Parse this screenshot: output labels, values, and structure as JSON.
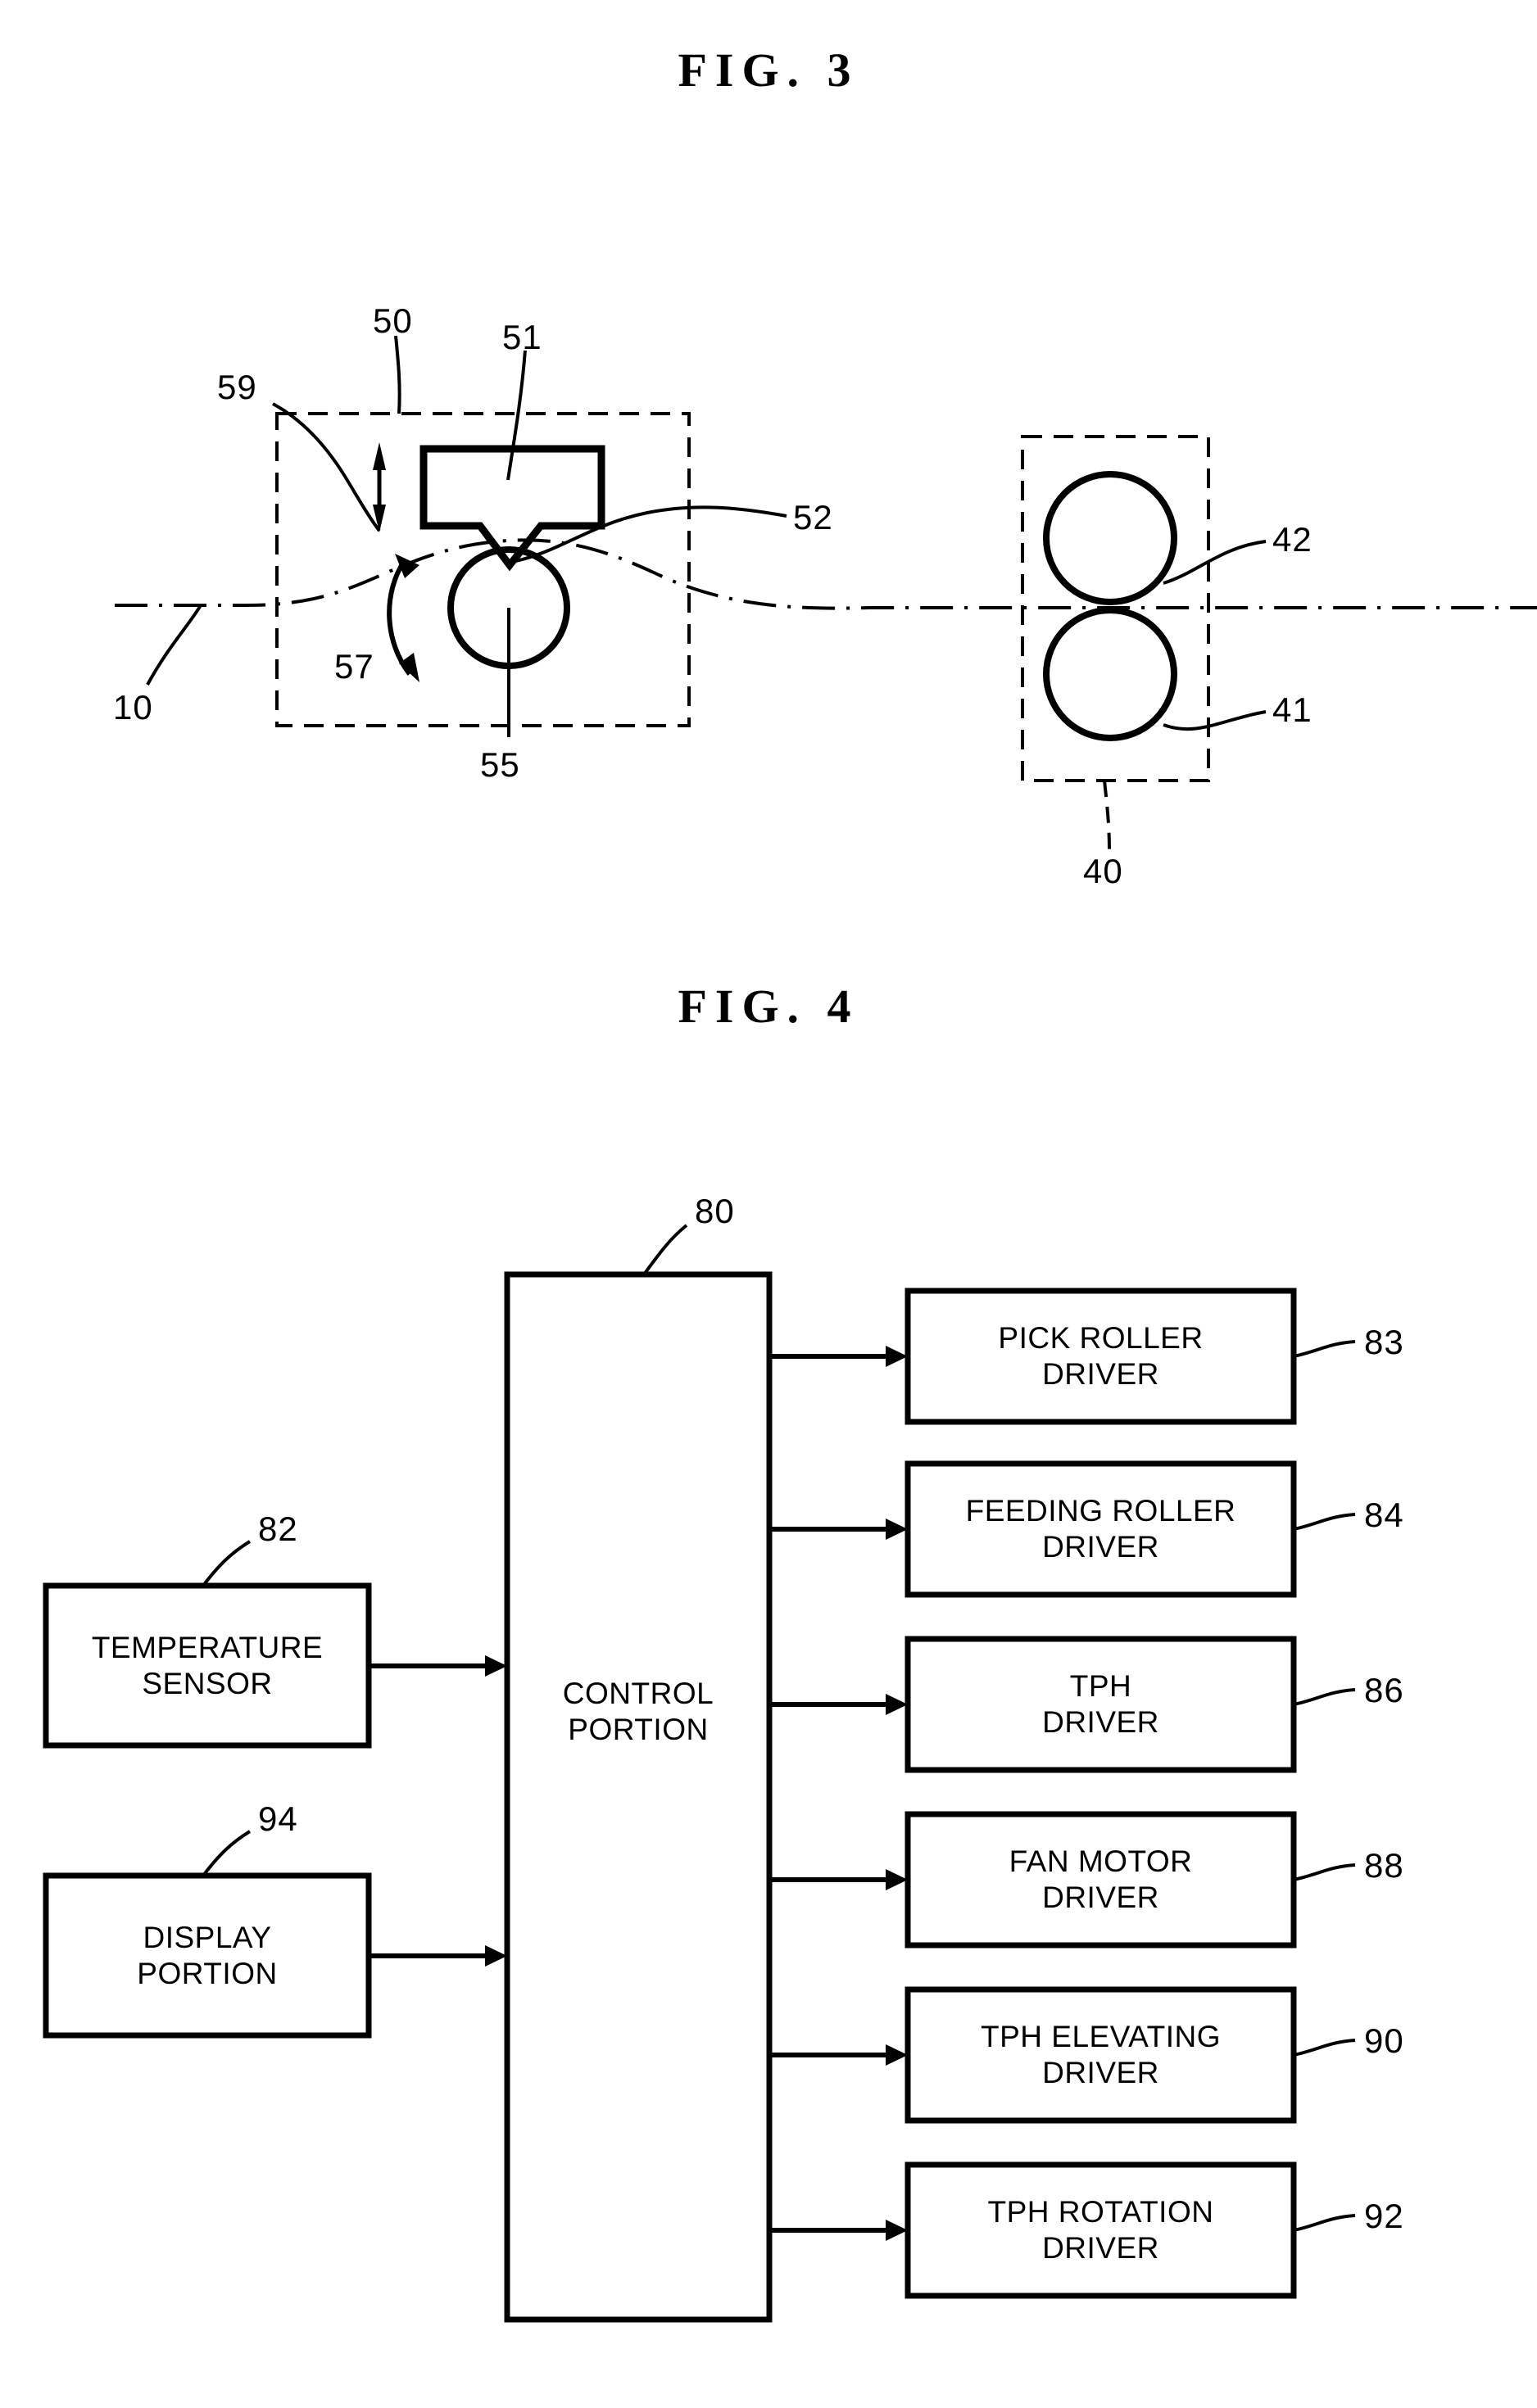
{
  "figures": [
    {
      "id": "fig3",
      "title": "FIG.  3",
      "kind": "mechanical-cross-section",
      "description": "Thermal print head unit and feeding roller pair along a paper path",
      "reference_numerals": [
        {
          "num": "50",
          "refers_to": "printing-unit-dashed-enclosure"
        },
        {
          "num": "51",
          "refers_to": "thermal-print-head-body"
        },
        {
          "num": "52",
          "refers_to": "print-head-tip"
        },
        {
          "num": "55",
          "refers_to": "platen-roller"
        },
        {
          "num": "57",
          "refers_to": "platen-roller-rotation-arrow"
        },
        {
          "num": "59",
          "refers_to": "print-head-elevating-arrow"
        },
        {
          "num": "10",
          "refers_to": "paper-path"
        },
        {
          "num": "40",
          "refers_to": "feeding-roller-dashed-enclosure"
        },
        {
          "num": "41",
          "refers_to": "lower-feeding-roller"
        },
        {
          "num": "42",
          "refers_to": "upper-feeding-roller"
        }
      ]
    },
    {
      "id": "fig4",
      "title": "FIG.  4",
      "kind": "block-diagram",
      "description": "Control portion block diagram with inputs and driver outputs",
      "control": {
        "label": "CONTROL\nPORTION",
        "ref": "80"
      },
      "inputs": [
        {
          "label": "TEMPERATURE\nSENSOR",
          "ref": "82"
        },
        {
          "label": "DISPLAY\nPORTION",
          "ref": "94"
        }
      ],
      "outputs": [
        {
          "label": "PICK ROLLER\nDRIVER",
          "ref": "83"
        },
        {
          "label": "FEEDING ROLLER\nDRIVER",
          "ref": "84"
        },
        {
          "label": "TPH\nDRIVER",
          "ref": "86"
        },
        {
          "label": "FAN MOTOR\nDRIVER",
          "ref": "88"
        },
        {
          "label": "TPH ELEVATING\nDRIVER",
          "ref": "90"
        },
        {
          "label": "TPH ROTATION\nDRIVER",
          "ref": "92"
        }
      ]
    }
  ],
  "colors": {
    "ink": "#000000",
    "paper": "#ffffff"
  }
}
